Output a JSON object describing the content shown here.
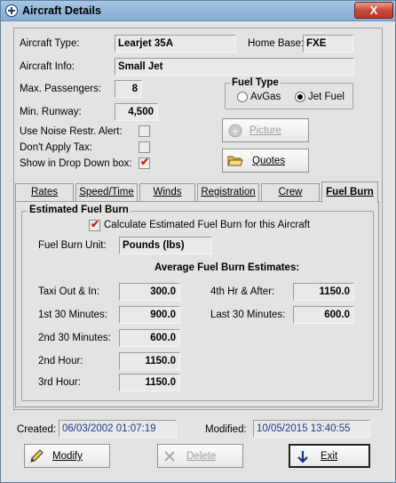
{
  "window": {
    "title": "Aircraft Details",
    "close_label": "X"
  },
  "aircraft": {
    "type_label": "Aircraft Type:",
    "type_value": "Learjet 35A",
    "home_base_label": "Home Base:",
    "home_base_value": "FXE",
    "info_label": "Aircraft Info:",
    "info_value": "Small Jet",
    "max_passengers_label": "Max. Passengers:",
    "max_passengers_value": "8",
    "min_runway_label": "Min. Runway:",
    "min_runway_value": "4,500",
    "noise_label": "Use Noise Restr. Alert:",
    "noise_checked": false,
    "tax_label": "Don't Apply Tax:",
    "tax_checked": false,
    "dropdown_label": "Show in Drop Down box:",
    "dropdown_checked": true
  },
  "fuel_type": {
    "title": "Fuel Type",
    "options": [
      "AvGas",
      "Jet Fuel"
    ],
    "selected": "Jet Fuel"
  },
  "buttons": {
    "picture": "Picture",
    "quotes": "Quotes",
    "modify": "Modify",
    "delete": "Delete",
    "exit": "Exit"
  },
  "tabs": [
    {
      "label": "Rates",
      "active": false
    },
    {
      "label": "Speed/Time",
      "active": false
    },
    {
      "label": "Winds",
      "active": false
    },
    {
      "label": "Registration",
      "active": false
    },
    {
      "label": "Crew",
      "active": false
    },
    {
      "label": "Fuel Burn",
      "active": true
    }
  ],
  "fuel_burn": {
    "group_title": "Estimated Fuel Burn",
    "calc_label": "Calculate Estimated Fuel Burn for this Aircraft",
    "calc_checked": true,
    "unit_label": "Fuel Burn Unit:",
    "unit_value": "Pounds (lbs)",
    "avg_heading": "Average Fuel Burn Estimates:",
    "taxi_label": "Taxi Out & In:",
    "taxi_value": "300.0",
    "first30_label": "1st 30 Minutes:",
    "first30_value": "900.0",
    "second30_label": "2nd 30 Minutes:",
    "second30_value": "600.0",
    "second_hour_label": "2nd Hour:",
    "second_hour_value": "1150.0",
    "third_hour_label": "3rd Hour:",
    "third_hour_value": "1150.0",
    "fourth_label": "4th Hr & After:",
    "fourth_value": "1150.0",
    "last30_label": "Last 30 Minutes:",
    "last30_value": "600.0"
  },
  "footer": {
    "created_label": "Created:",
    "created_value": "06/03/2002 01:07:19",
    "modified_label": "Modified:",
    "modified_value": "10/05/2015 13:40:55"
  },
  "icons": {
    "picture": "camera-icon",
    "quotes": "folder-open-icon",
    "modify": "pencil-icon",
    "delete": "delete-x-icon",
    "exit": "exit-arrow-icon"
  }
}
